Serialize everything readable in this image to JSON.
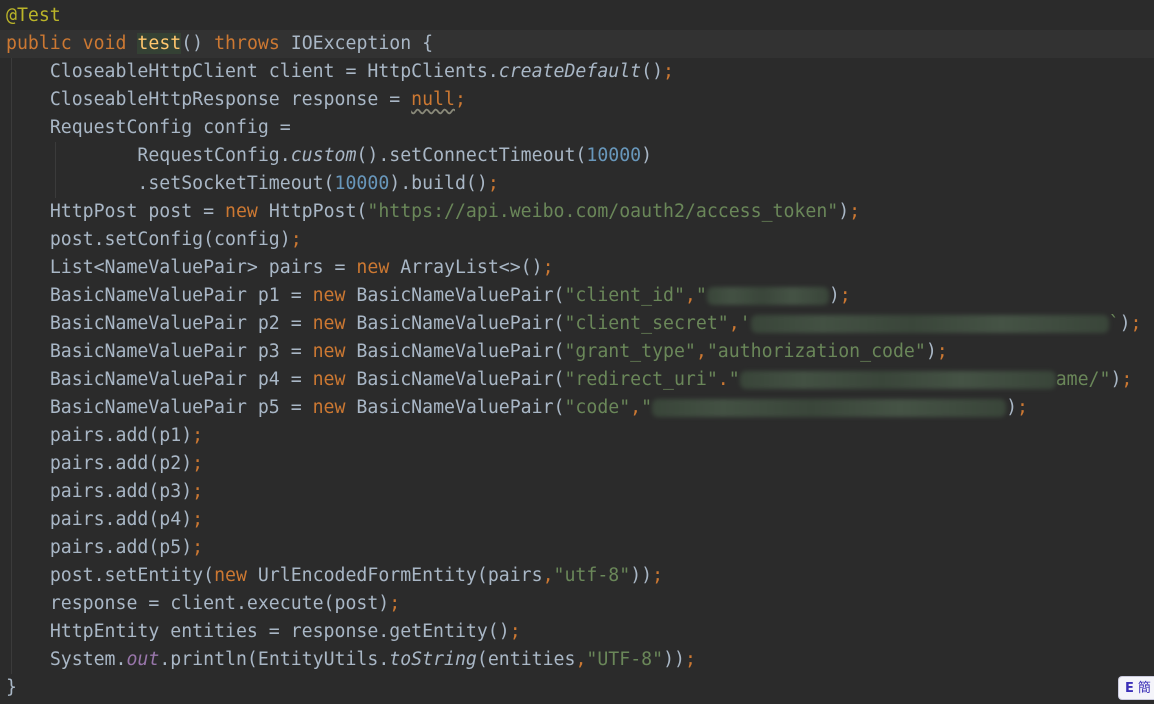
{
  "editor": {
    "lines": {
      "l1": {
        "annotation": "@Test"
      },
      "l2": {
        "kw_public": "public",
        "kw_void": "void",
        "method": "test",
        "paren": "() ",
        "kw_throws": "throws",
        "rest": " IOException {"
      },
      "l3": {
        "a": "CloseableHttpClient client = HttpClients.",
        "call": "createDefault",
        "b": "()",
        "semi": ";"
      },
      "l4": {
        "a": "CloseableHttpResponse response = ",
        "kw_null": "null",
        "semi": ";"
      },
      "l5": {
        "a": "RequestConfig config ="
      },
      "l6": {
        "a": "RequestConfig.",
        "call": "custom",
        "b": "().setConnectTimeout(",
        "num": "10000",
        "c": ")"
      },
      "l7": {
        "a": ".setSocketTimeout(",
        "num": "10000",
        "b": ").build()",
        "semi": ";"
      },
      "l8": {
        "a": "HttpPost post = ",
        "kw_new": "new",
        "b": " HttpPost(",
        "str": "\"https://api.weibo.com/oauth2/access_token\"",
        "c": ")",
        "semi": ";"
      },
      "l9": {
        "a": "post.setConfig(config)",
        "semi": ";"
      },
      "l10": {
        "a": "List<NameValuePair> pairs = ",
        "kw_new": "new",
        "b": " ArrayList<>()",
        "semi": ";"
      },
      "l11": {
        "a": "BasicNameValuePair p1 = ",
        "kw_new": "new",
        "b": " BasicNameValuePair(",
        "str1": "\"client_id\"",
        "comma": ",",
        "str2": "\"",
        "c": ")",
        "semi": ";"
      },
      "l12": {
        "a": "BasicNameValuePair p2 = ",
        "kw_new": "new",
        "b": " BasicNameValuePair(",
        "str1": "\"client_secret\"",
        "comma": ",",
        "str2": "'",
        "tail": "`",
        "c": ")",
        "semi": ";"
      },
      "l13": {
        "a": "BasicNameValuePair p3 = ",
        "kw_new": "new",
        "b": " BasicNameValuePair(",
        "str1": "\"grant_type\"",
        "comma": ",",
        "str2": "\"authorization_code\"",
        "c": ")",
        "semi": ";"
      },
      "l14": {
        "a": "BasicNameValuePair p4 = ",
        "kw_new": "new",
        "b": " BasicNameValuePair(",
        "str1": "\"redirect_uri\"",
        "comma": ".",
        "str2": "\"",
        "tail": "ame/\"",
        "c": ")",
        "semi": ";"
      },
      "l15": {
        "a": "BasicNameValuePair p5 = ",
        "kw_new": "new",
        "b": " BasicNameValuePair(",
        "str1": "\"code\"",
        "comma": ",",
        "str2": "\"",
        "c": ")",
        "semi": ";"
      },
      "l16": {
        "a": "pairs.add(p1)",
        "semi": ";"
      },
      "l17": {
        "a": "pairs.add(p2)",
        "semi": ";"
      },
      "l18": {
        "a": "pairs.add(p3)",
        "semi": ";"
      },
      "l19": {
        "a": "pairs.add(p4)",
        "semi": ";"
      },
      "l20": {
        "a": "pairs.add(p5)",
        "semi": ";"
      },
      "l21": {
        "a": "post.setEntity(",
        "kw_new": "new",
        "b": " UrlEncodedFormEntity(pairs",
        "comma": ",",
        "str": "\"utf-8\"",
        "c": "))",
        "semi": ";"
      },
      "l22": {
        "a": "response = client.execute(post)",
        "semi": ";"
      },
      "l23": {
        "a": "HttpEntity entities = response.getEntity()",
        "semi": ";"
      },
      "l24": {
        "a": "System.",
        "field": "out",
        "b": ".println(EntityUtils.",
        "call": "toString",
        "c": "(entities",
        "comma": ",",
        "str": "\"UTF-8\"",
        "d": "))",
        "semi": ";"
      },
      "l25": {
        "a": "}"
      }
    }
  },
  "ime_indicator": {
    "mode": "E",
    "glyph": "簡"
  },
  "colors": {
    "background": "#2b2b2b",
    "current_line": "#323232",
    "keyword": "#cc7832",
    "string": "#6a8759",
    "number": "#6897bb",
    "method": "#ffc66d",
    "annotation": "#bbb529",
    "static_field": "#9876aa",
    "text": "#a9b7c6"
  }
}
